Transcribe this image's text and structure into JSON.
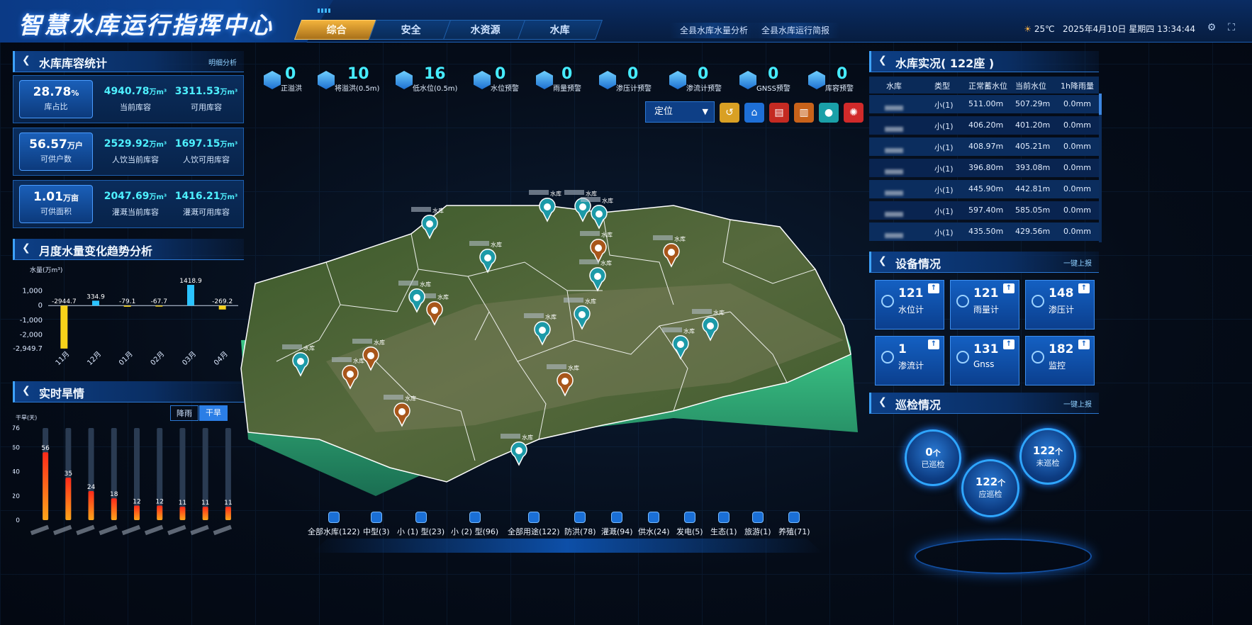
{
  "header": {
    "title": "智慧水库运行指挥中心",
    "tabs": [
      {
        "label": "综合",
        "active": true
      },
      {
        "label": "安全",
        "active": false
      },
      {
        "label": "水资源",
        "active": false
      },
      {
        "label": "水库",
        "active": false
      }
    ],
    "sub_links": [
      "全县水库水量分析",
      "全县水库运行简报"
    ],
    "weather": "25℃",
    "datetime": "2025年4月10日 星期四 13:34:44"
  },
  "capacity": {
    "title": "水库库容统计",
    "link": "明细分析",
    "cards": [
      {
        "main_value": "28.78",
        "main_unit": "%",
        "main_label": "库占比",
        "c1_value": "4940.78",
        "c1_unit": "万m³",
        "c1_label": "当前库容",
        "c2_value": "3311.53",
        "c2_unit": "万m³",
        "c2_label": "可用库容"
      },
      {
        "main_value": "56.57",
        "main_unit": "万户",
        "main_label": "可供户数",
        "c1_value": "2529.92",
        "c1_unit": "万m³",
        "c1_label": "人饮当前库容",
        "c2_value": "1697.15",
        "c2_unit": "万m³",
        "c2_label": "人饮可用库容"
      },
      {
        "main_value": "1.01",
        "main_unit": "万亩",
        "main_label": "可供面积",
        "c1_value": "2047.69",
        "c1_unit": "万m³",
        "c1_label": "灌溉当前库容",
        "c2_value": "1416.21",
        "c2_unit": "万m³",
        "c2_label": "灌溉可用库容"
      }
    ]
  },
  "monthly": {
    "title": "月度水量变化趋势分析"
  },
  "drought": {
    "title": "实时旱情",
    "toggle": [
      "降雨",
      "干旱"
    ],
    "ylabel": "干旱(天)"
  },
  "chart_data": [
    {
      "type": "bar",
      "ylabel": "水量(万m³)",
      "categories": [
        "11月",
        "12月",
        "01月",
        "02月",
        "03月",
        "04月"
      ],
      "values": [
        -2944.7,
        334.9,
        -79.1,
        -67.7,
        1418.9,
        -269.2
      ],
      "yticks": [
        "1,000",
        "0",
        "-1,000",
        "-2,000",
        "-2,949.7"
      ],
      "ylim": [
        -2949.7,
        1418.9
      ]
    },
    {
      "type": "bar",
      "ylabel": "干旱(天)",
      "categories": [
        "",
        "",
        "",
        "",
        "",
        "",
        "",
        "",
        ""
      ],
      "values": [
        56,
        35,
        24,
        18,
        12,
        12,
        11,
        11,
        11
      ],
      "yticks": [
        "76",
        "60",
        "40",
        "20",
        "0"
      ],
      "ylim": [
        0,
        76
      ]
    }
  ],
  "alarms": [
    {
      "value": "0",
      "label": "正溢洪"
    },
    {
      "value": "10",
      "label": "将溢洪(0.5m)"
    },
    {
      "value": "16",
      "label": "低水位(0.5m)"
    },
    {
      "value": "0",
      "label": "水位预警"
    },
    {
      "value": "0",
      "label": "雨量预警"
    },
    {
      "value": "0",
      "label": "渗压计预警"
    },
    {
      "value": "0",
      "label": "渗流计预警"
    },
    {
      "value": "0",
      "label": "GNSS预警"
    },
    {
      "value": "0",
      "label": "库容预警"
    }
  ],
  "locate": {
    "label": "定位"
  },
  "reservoir_table": {
    "title": "水库实况( 122座 )",
    "headers": [
      "水库",
      "类型",
      "正常蓄水位",
      "当前水位",
      "1h降雨量"
    ],
    "rows": [
      {
        "type": "小(1)",
        "normal": "511.00m",
        "current": "507.29m",
        "rain": "0.0mm"
      },
      {
        "type": "小(1)",
        "normal": "406.20m",
        "current": "401.20m",
        "rain": "0.0mm"
      },
      {
        "type": "小(1)",
        "normal": "408.97m",
        "current": "405.21m",
        "rain": "0.0mm"
      },
      {
        "type": "小(1)",
        "normal": "396.80m",
        "current": "393.08m",
        "rain": "0.0mm"
      },
      {
        "type": "小(1)",
        "normal": "445.90m",
        "current": "442.81m",
        "rain": "0.0mm"
      },
      {
        "type": "小(1)",
        "normal": "597.40m",
        "current": "585.05m",
        "rain": "0.0mm"
      },
      {
        "type": "小(1)",
        "normal": "435.50m",
        "current": "429.56m",
        "rain": "0.0mm"
      }
    ]
  },
  "devices": {
    "title": "设备情况",
    "link": "一键上报",
    "items": [
      {
        "value": "121",
        "label": "水位计"
      },
      {
        "value": "121",
        "label": "雨量计"
      },
      {
        "value": "148",
        "label": "渗压计"
      },
      {
        "value": "1",
        "label": "渗流计"
      },
      {
        "value": "131",
        "label": "Gnss"
      },
      {
        "value": "182",
        "label": "监控"
      }
    ]
  },
  "inspection": {
    "title": "巡检情况",
    "link": "一键上报",
    "done_value": "0",
    "done_unit": "个",
    "done_label": "已巡检",
    "todo_value": "122",
    "todo_unit": "个",
    "todo_label": "未巡检",
    "should_value": "122",
    "should_unit": "个",
    "should_label": "应巡检"
  },
  "map": {
    "reservoir_suffix": "水库",
    "markers": [
      {
        "kind": "water"
      },
      {
        "kind": "water"
      },
      {
        "kind": "water"
      },
      {
        "kind": "water"
      },
      {
        "kind": "building"
      },
      {
        "kind": "building"
      },
      {
        "kind": "water"
      },
      {
        "kind": "water"
      },
      {
        "kind": "building"
      },
      {
        "kind": "water"
      },
      {
        "kind": "water"
      },
      {
        "kind": "water"
      },
      {
        "kind": "water"
      },
      {
        "kind": "building"
      },
      {
        "kind": "water"
      },
      {
        "kind": "building"
      },
      {
        "kind": "water"
      },
      {
        "kind": "building"
      },
      {
        "kind": "building"
      },
      {
        "kind": "water"
      }
    ]
  },
  "legend": [
    "全部水库(122)",
    "中型(3)",
    "小 (1) 型(23)",
    "小 (2) 型(96)",
    "全部用途(122)",
    "防洪(78)",
    "灌溉(94)",
    "供水(24)",
    "发电(5)",
    "生态(1)",
    "旅游(1)",
    "养殖(71)"
  ],
  "colors": {
    "accent": "#46ecff",
    "active_tab": "#f3b33c",
    "bar_pos": "#2bc3ff",
    "bar_neg": "#f7d21a",
    "drought_top": "#ff2a1a",
    "drought_bottom": "#ffa51a"
  }
}
